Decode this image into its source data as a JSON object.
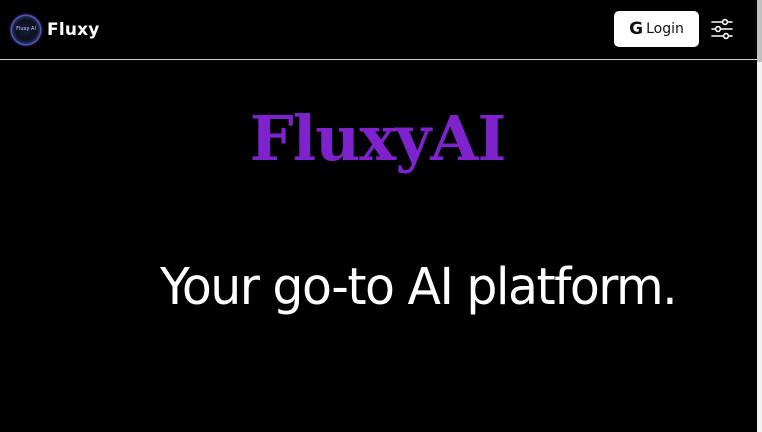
{
  "header": {
    "brand_name": "Fluxy",
    "logo_text": "Fluxy AI",
    "login_label": "Login",
    "google_icon": "google-g-icon",
    "settings_icon": "sliders-icon"
  },
  "hero": {
    "title": "FluxyAI",
    "tagline": "Your go-to AI platform."
  },
  "colors": {
    "background": "#000000",
    "accent": "#7e22ce",
    "text": "#ffffff"
  }
}
